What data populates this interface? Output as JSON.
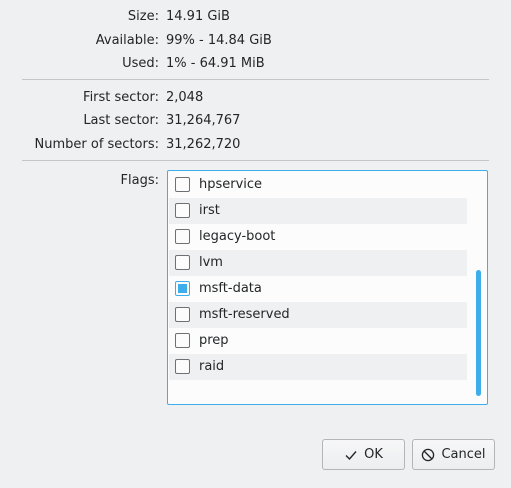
{
  "info": {
    "size_label": "Size:",
    "size_value": "14.91 GiB",
    "available_label": "Available:",
    "available_value": "99% - 14.84 GiB",
    "used_label": "Used:",
    "used_value": "1% - 64.91 MiB",
    "first_sector_label": "First sector:",
    "first_sector_value": "2,048",
    "last_sector_label": "Last sector:",
    "last_sector_value": "31,264,767",
    "num_sectors_label": "Number of sectors:",
    "num_sectors_value": "31,262,720"
  },
  "flags": {
    "label": "Flags:",
    "items": [
      {
        "label": "hpservice",
        "checked": false
      },
      {
        "label": "irst",
        "checked": false
      },
      {
        "label": "legacy-boot",
        "checked": false
      },
      {
        "label": "lvm",
        "checked": false
      },
      {
        "label": "msft-data",
        "checked": true
      },
      {
        "label": "msft-reserved",
        "checked": false
      },
      {
        "label": "prep",
        "checked": false
      },
      {
        "label": "raid",
        "checked": false
      }
    ]
  },
  "buttons": {
    "ok_label": "OK",
    "cancel_label": "Cancel"
  },
  "icons": {
    "ok": "checkmark-icon",
    "cancel": "cancel-icon"
  },
  "colors": {
    "accent": "#3daee9"
  }
}
